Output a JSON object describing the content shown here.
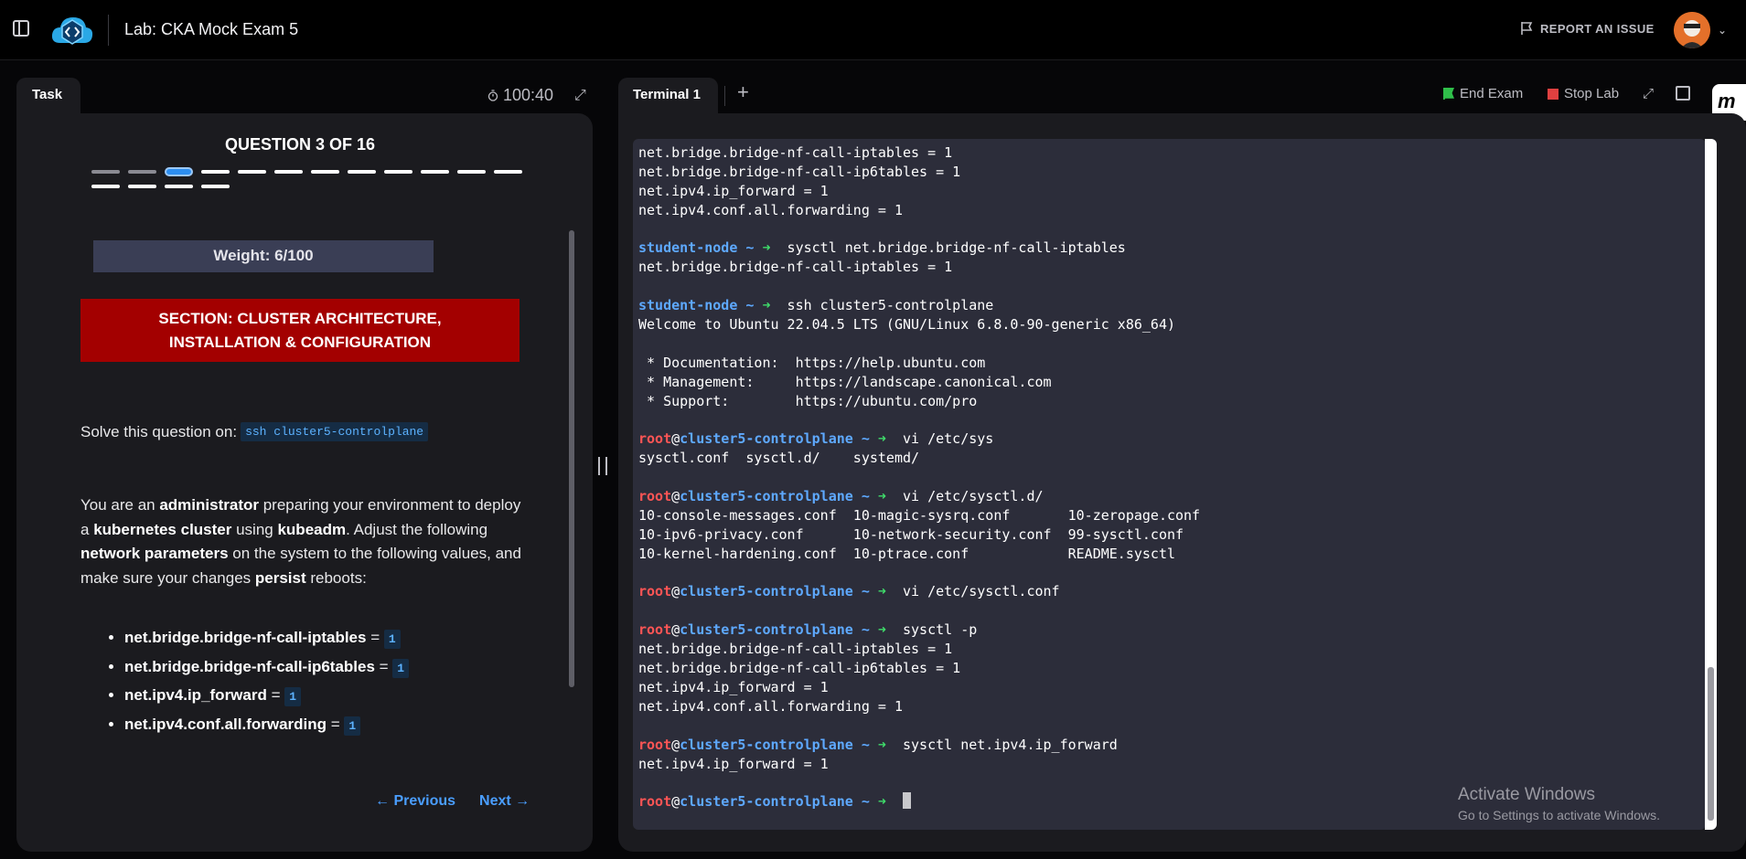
{
  "header": {
    "title": "Lab: CKA Mock Exam 5",
    "report_label": "REPORT AN ISSUE"
  },
  "task": {
    "tab_label": "Task",
    "timer": "100:40",
    "question_title": "QUESTION 3 OF 16",
    "progress": {
      "total": 16,
      "current": 3
    },
    "weight": "Weight: 6/100",
    "section": "SECTION: CLUSTER ARCHITECTURE, INSTALLATION & CONFIGURATION",
    "solve_prefix": "Solve this question on:",
    "solve_command": "ssh cluster5-controlplane",
    "desc": {
      "p1": "You are an ",
      "b1": "administrator",
      "p2": " preparing your environment to deploy a ",
      "b2": "kubernetes cluster",
      "p3": " using ",
      "b3": "kubeadm",
      "p4": ". Adjust the following ",
      "b4": "network parameters",
      "p5": " on the system to the following values, and make sure your changes ",
      "b5": "persist",
      "p6": " reboots:"
    },
    "params": [
      {
        "name": "net.bridge.bridge-nf-call-iptables",
        "eq": " = ",
        "value": "1"
      },
      {
        "name": "net.bridge.bridge-nf-call-ip6tables",
        "eq": " = ",
        "value": "1"
      },
      {
        "name": "net.ipv4.ip_forward",
        "eq": " = ",
        "value": "1"
      },
      {
        "name": "net.ipv4.conf.all.forwarding",
        "eq": " = ",
        "value": "1"
      }
    ],
    "prev_label": "Previous",
    "next_label": "Next"
  },
  "terminal": {
    "tab_label": "Terminal 1",
    "end_exam_label": "End Exam",
    "stop_lab_label": "Stop Lab",
    "brand": "m",
    "lines": [
      {
        "out": "net.bridge.bridge-nf-call-iptables = 1"
      },
      {
        "out": "net.bridge.bridge-nf-call-ip6tables = 1"
      },
      {
        "out": "net.ipv4.ip_forward = 1"
      },
      {
        "out": "net.ipv4.conf.all.forwarding = 1"
      },
      {
        "out": ""
      },
      {
        "user": "student-node",
        "sep": " ~ ",
        "arrow": "➜ ",
        "cmd": " sysctl net.bridge.bridge-nf-call-iptables"
      },
      {
        "out": "net.bridge.bridge-nf-call-iptables = 1"
      },
      {
        "out": ""
      },
      {
        "user": "student-node",
        "sep": " ~ ",
        "arrow": "➜ ",
        "cmd": " ssh cluster5-controlplane"
      },
      {
        "out": "Welcome to Ubuntu 22.04.5 LTS (GNU/Linux 6.8.0-90-generic x86_64)"
      },
      {
        "out": ""
      },
      {
        "out": " * Documentation:  https://help.ubuntu.com"
      },
      {
        "out": " * Management:     https://landscape.canonical.com"
      },
      {
        "out": " * Support:        https://ubuntu.com/pro"
      },
      {
        "out": ""
      },
      {
        "root": "root",
        "at": "@",
        "host": "cluster5-controlplane",
        "sep": " ~ ",
        "arrow": "➜ ",
        "cmd": " vi /etc/sys"
      },
      {
        "out": "sysctl.conf  sysctl.d/    systemd/"
      },
      {
        "out": ""
      },
      {
        "root": "root",
        "at": "@",
        "host": "cluster5-controlplane",
        "sep": " ~ ",
        "arrow": "➜ ",
        "cmd": " vi /etc/sysctl.d/"
      },
      {
        "out": "10-console-messages.conf  10-magic-sysrq.conf       10-zeropage.conf"
      },
      {
        "out": "10-ipv6-privacy.conf      10-network-security.conf  99-sysctl.conf"
      },
      {
        "out": "10-kernel-hardening.conf  10-ptrace.conf            README.sysctl"
      },
      {
        "out": ""
      },
      {
        "root": "root",
        "at": "@",
        "host": "cluster5-controlplane",
        "sep": " ~ ",
        "arrow": "➜ ",
        "cmd": " vi /etc/sysctl.conf"
      },
      {
        "out": ""
      },
      {
        "root": "root",
        "at": "@",
        "host": "cluster5-controlplane",
        "sep": " ~ ",
        "arrow": "➜ ",
        "cmd": " sysctl -p"
      },
      {
        "out": "net.bridge.bridge-nf-call-iptables = 1"
      },
      {
        "out": "net.bridge.bridge-nf-call-ip6tables = 1"
      },
      {
        "out": "net.ipv4.ip_forward = 1"
      },
      {
        "out": "net.ipv4.conf.all.forwarding = 1"
      },
      {
        "out": ""
      },
      {
        "root": "root",
        "at": "@",
        "host": "cluster5-controlplane",
        "sep": " ~ ",
        "arrow": "➜ ",
        "cmd": " sysctl net.ipv4.ip_forward"
      },
      {
        "out": "net.ipv4.ip_forward = 1"
      },
      {
        "out": ""
      },
      {
        "root": "root",
        "at": "@",
        "host": "cluster5-controlplane",
        "sep": " ~ ",
        "arrow": "➜ ",
        "cmd": " ",
        "cursor": true
      }
    ],
    "scroll_position": 0.87
  },
  "watermark": {
    "line1": "Activate Windows",
    "line2": "Go to Settings to activate Windows."
  },
  "colors": {
    "prompt_root": "#ff5555",
    "prompt_host": "#5ea9ff",
    "prompt_arrow": "#3fdc6a",
    "section_bg": "#a30000",
    "accent": "#4a9eff"
  },
  "icons": [
    "sidebar-toggle-icon",
    "cloud-code-logo-icon",
    "flag-icon",
    "avatar",
    "chevron-down-icon",
    "stopwatch-icon",
    "expand-icon",
    "plus-icon",
    "green-flag-icon",
    "stop-square-icon",
    "open-external-icon",
    "arrow-left-icon",
    "arrow-right-icon"
  ]
}
